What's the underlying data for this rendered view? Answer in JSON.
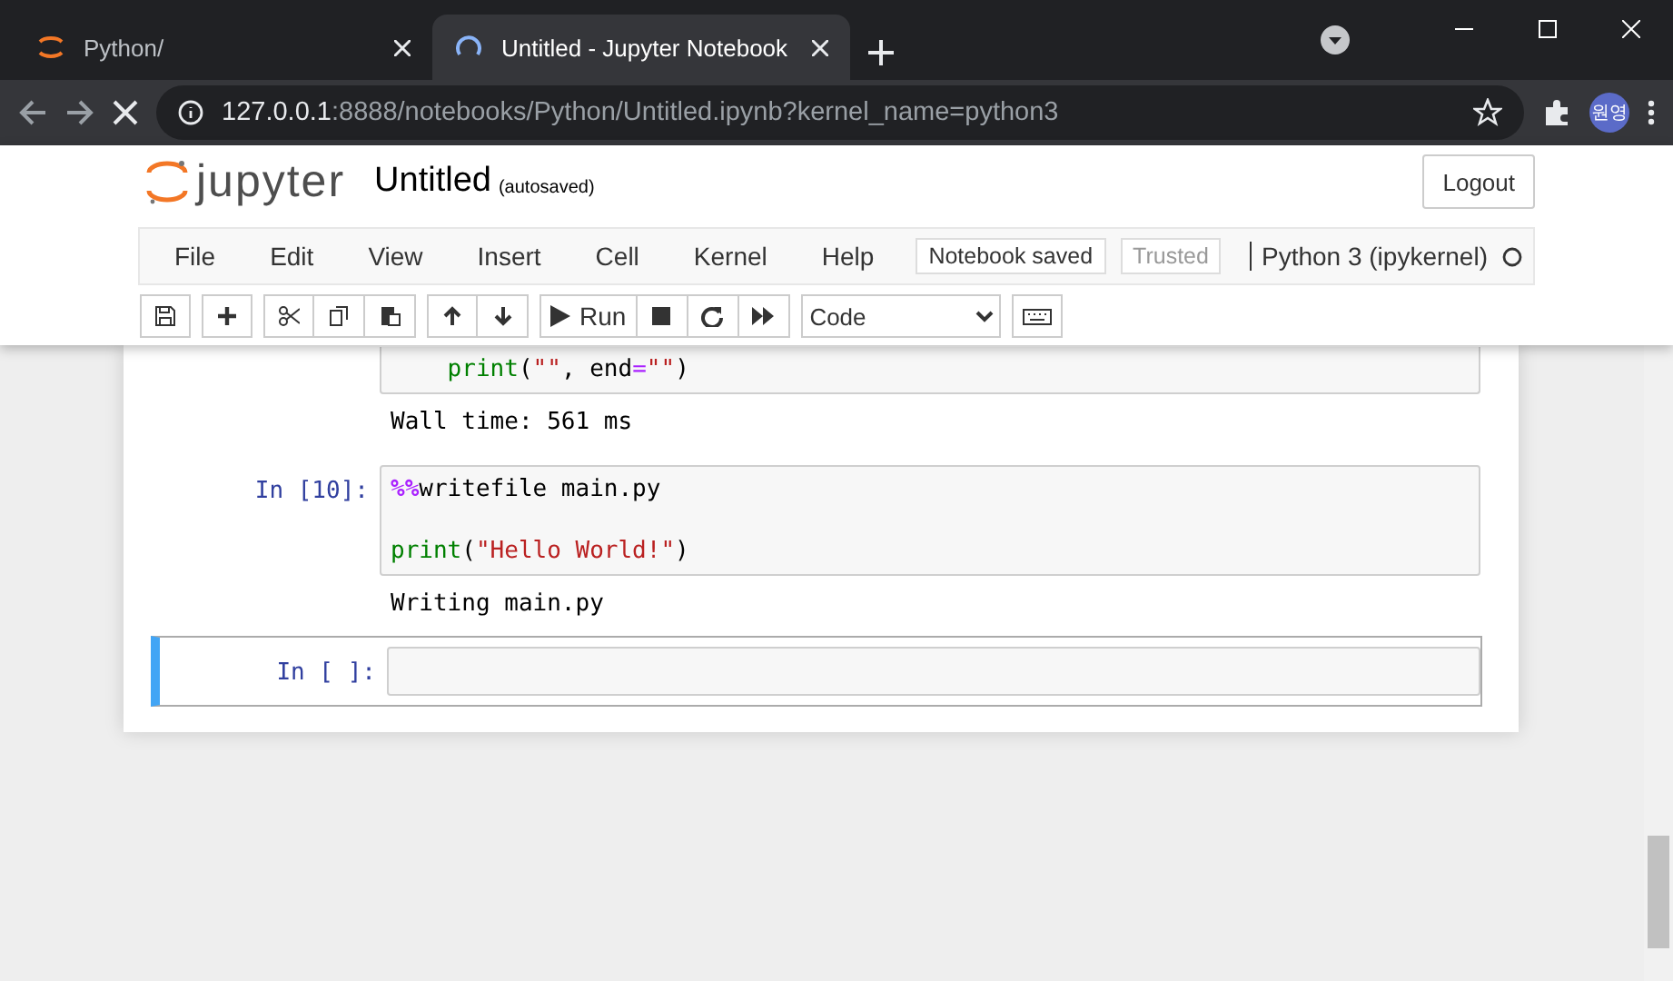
{
  "browser": {
    "tabs": [
      {
        "title": "Python/",
        "selected": false,
        "kind": "jupyter"
      },
      {
        "title": "Untitled - Jupyter Notebook",
        "selected": true,
        "kind": "loading"
      }
    ],
    "address": {
      "host": "127.0.0.1",
      "rest": ":8888/notebooks/Python/Untitled.ipynb?kernel_name=python3"
    },
    "profile": "원영"
  },
  "header": {
    "logo": "jupyter",
    "notebook_name": "Untitled",
    "save_status": "(autosaved)",
    "logout": "Logout"
  },
  "menu": {
    "items": [
      "File",
      "Edit",
      "View",
      "Insert",
      "Cell",
      "Kernel",
      "Help"
    ],
    "notebook_status": "Notebook saved",
    "trusted": "Trusted",
    "kernel": "Python 3 (ipykernel)"
  },
  "toolbar": {
    "run": "Run",
    "cell_type": "Code"
  },
  "cells": [
    {
      "selected": false,
      "lines": [
        [
          {
            "kind": "builtin",
            "text": "    print"
          },
          {
            "kind": "plain",
            "text": "("
          },
          {
            "kind": "string",
            "text": "\"\""
          },
          {
            "kind": "plain",
            "text": ", end"
          },
          {
            "kind": "operator",
            "text": "="
          },
          {
            "kind": "string",
            "text": "\"\""
          },
          {
            "kind": "plain",
            "text": ")"
          }
        ]
      ],
      "output": "Wall time: 561 ms"
    },
    {
      "selected": false,
      "prompt": "In [10]:",
      "lines": [
        [
          {
            "kind": "magic",
            "text": "%%"
          },
          {
            "kind": "plain",
            "text": "writefile main.py\n\n"
          },
          {
            "kind": "builtin",
            "text": "print"
          },
          {
            "kind": "plain",
            "text": "("
          },
          {
            "kind": "string",
            "text": "\"Hello World!\""
          },
          {
            "kind": "plain",
            "text": ")"
          }
        ]
      ],
      "output": "Writing main.py"
    },
    {
      "selected": true,
      "prompt": "In [ ]:"
    }
  ]
}
